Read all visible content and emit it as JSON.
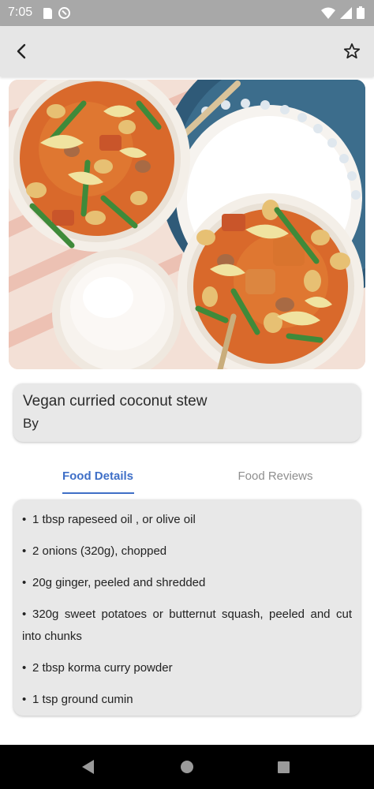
{
  "status_bar": {
    "time": "7:05",
    "icons": [
      "sd-card-icon",
      "sync-icon",
      "wifi-icon",
      "signal-icon",
      "battery-icon"
    ]
  },
  "app_bar": {
    "back_icon": "chevron-left-icon",
    "favorite_icon": "star-outline-icon"
  },
  "hero_image": {
    "subject": "two bowls of curried coconut stew with yogurt"
  },
  "recipe": {
    "title": "Vegan curried coconut stew",
    "author_label": "By"
  },
  "tabs": [
    {
      "label": "Food Details",
      "active": true
    },
    {
      "label": "Food Reviews",
      "active": false
    }
  ],
  "ingredients": [
    "1 tbsp  rapeseed oil , or olive oil",
    "2 onions (320g), chopped",
    "20g ginger, peeled and shredded",
    "320g  sweet  potatoes  or  butternut  squash,  peeled  and cut into chunks",
    "2 tbsp  korma curry powder",
    "1 tsp  ground cumin"
  ],
  "colors": {
    "status_bar": "#a8a8a8",
    "app_bar": "#e6e6e6",
    "card_bg": "#e8e8e8",
    "accent": "#3f6fc7",
    "inactive_tab": "#8e8e8e",
    "nav_bar": "#000000"
  },
  "nav_bar": {
    "icons": [
      "nav-back-icon",
      "nav-home-icon",
      "nav-recents-icon"
    ]
  }
}
